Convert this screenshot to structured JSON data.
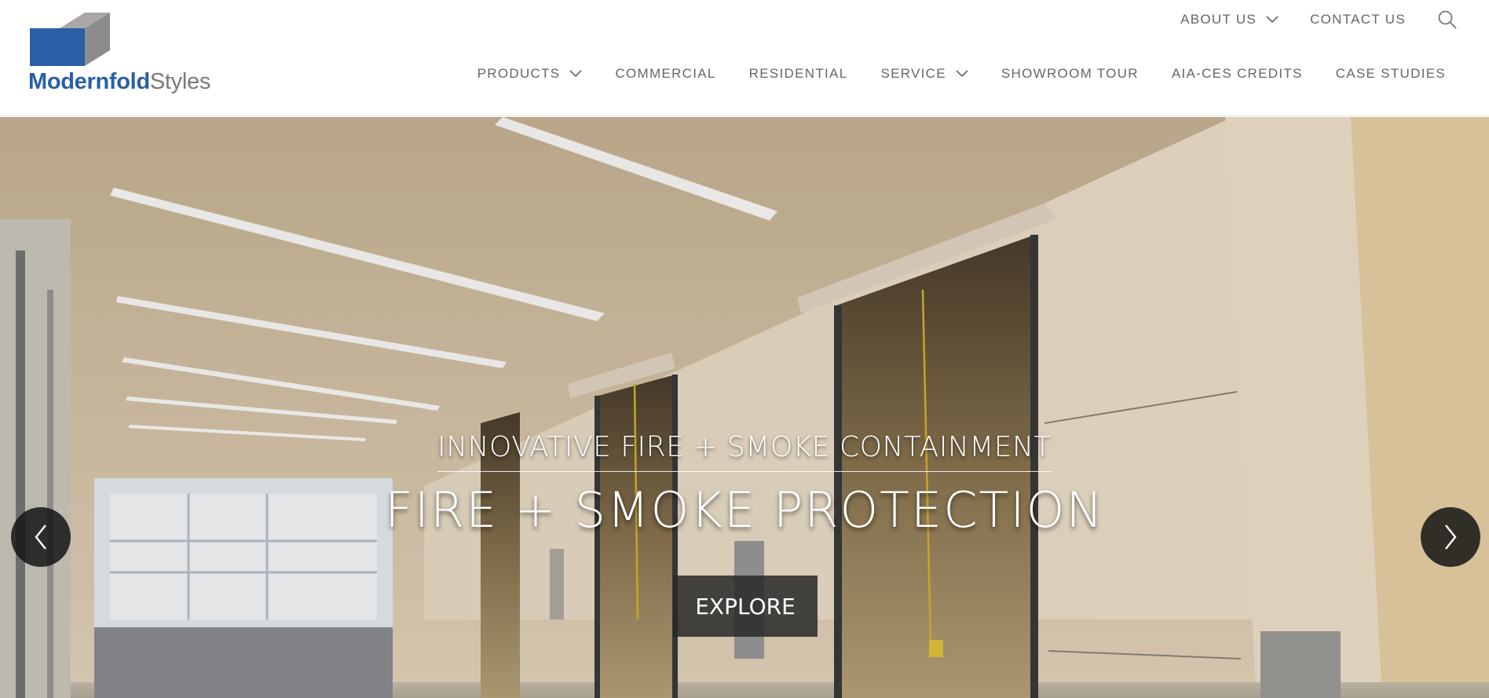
{
  "brand": {
    "name_bold": "Modernfold",
    "name_regular": "Styles",
    "colors": {
      "blue": "#2a5fa6",
      "gray": "#8c8c8c"
    }
  },
  "top_nav": {
    "about_label": "ABOUT US",
    "contact_label": "CONTACT US",
    "search_icon": "search-icon"
  },
  "main_nav": {
    "items": [
      {
        "label": "PRODUCTS",
        "has_dropdown": true
      },
      {
        "label": "COMMERCIAL",
        "has_dropdown": false
      },
      {
        "label": "RESIDENTIAL",
        "has_dropdown": false
      },
      {
        "label": "SERVICE",
        "has_dropdown": true
      },
      {
        "label": "SHOWROOM TOUR",
        "has_dropdown": false
      },
      {
        "label": "AIA-CES CREDITS",
        "has_dropdown": false
      },
      {
        "label": "CASE STUDIES",
        "has_dropdown": false
      }
    ]
  },
  "hero": {
    "subtitle": "INNOVATIVE FIRE + SMOKE CONTAINMENT",
    "title": "FIRE + SMOKE PROTECTION",
    "cta_label": "EXPLORE",
    "prev_icon": "chevron-left-icon",
    "next_icon": "chevron-right-icon"
  }
}
